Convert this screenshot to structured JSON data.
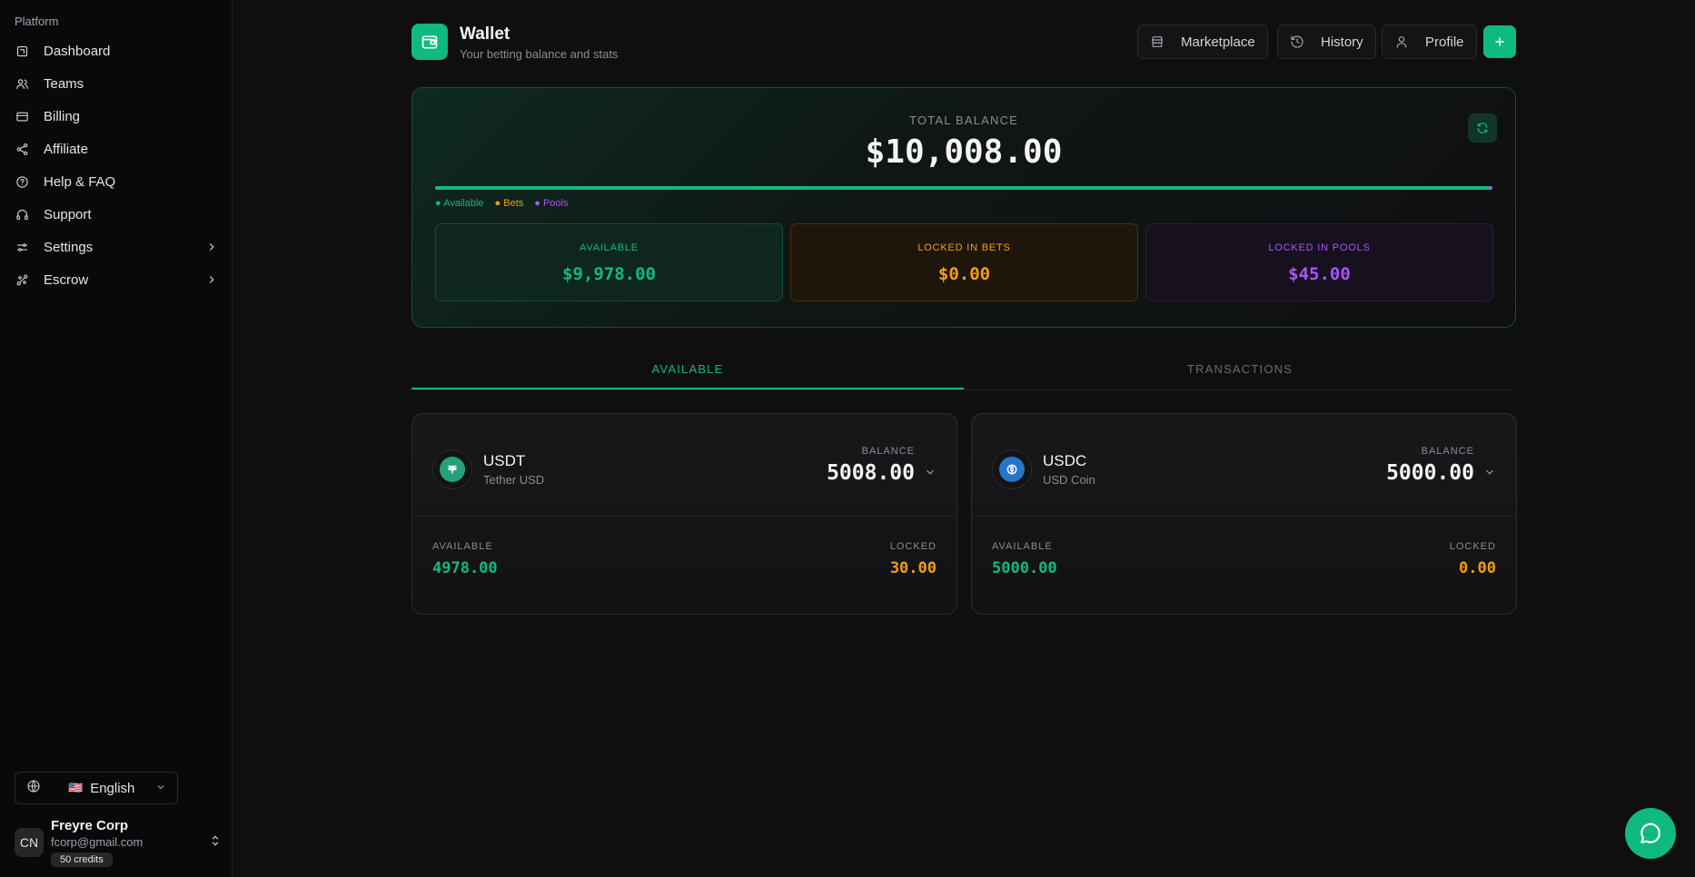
{
  "sidebar": {
    "section_label": "Platform",
    "items": [
      {
        "label": "Dashboard",
        "icon": "dashboard-icon"
      },
      {
        "label": "Teams",
        "icon": "users-icon"
      },
      {
        "label": "Billing",
        "icon": "credit-card-icon"
      },
      {
        "label": "Affiliate",
        "icon": "share-icon"
      },
      {
        "label": "Help & FAQ",
        "icon": "help-circle-icon"
      },
      {
        "label": "Support",
        "icon": "headphones-icon"
      },
      {
        "label": "Settings",
        "icon": "sliders-icon",
        "has_submenu": true
      },
      {
        "label": "Escrow",
        "icon": "link-icon",
        "has_submenu": true
      }
    ],
    "language": {
      "flag": "🇺🇸",
      "label": "English"
    },
    "user": {
      "initials": "CN",
      "name": "Freyre Corp",
      "email": "fcorp@gmail.com",
      "credits": "50 credits"
    }
  },
  "header": {
    "title": "Wallet",
    "subtitle": "Your betting balance and stats",
    "buttons": {
      "marketplace": "Marketplace",
      "history": "History",
      "profile": "Profile"
    }
  },
  "balance": {
    "label": "TOTAL BALANCE",
    "total": "$10,008.00",
    "distribution": {
      "available": 99.7,
      "bets": 0,
      "pools": 0.3
    },
    "legend": {
      "available": "● Available",
      "bets": "● Bets",
      "pools": "● Pools"
    },
    "stats": {
      "available": {
        "label": "AVAILABLE",
        "value": "$9,978.00"
      },
      "bets": {
        "label": "LOCKED IN BETS",
        "value": "$0.00"
      },
      "pools": {
        "label": "LOCKED IN POOLS",
        "value": "$45.00"
      }
    }
  },
  "tabs": {
    "available": "AVAILABLE",
    "transactions": "TRANSACTIONS",
    "active": "available"
  },
  "coins": [
    {
      "symbol": "USDT",
      "name": "Tether USD",
      "balance_label": "BALANCE",
      "balance": "5008.00",
      "available_label": "AVAILABLE",
      "available": "4978.00",
      "locked_label": "LOCKED",
      "locked": "30.00",
      "color": "#26a17b"
    },
    {
      "symbol": "USDC",
      "name": "USD Coin",
      "balance_label": "BALANCE",
      "balance": "5000.00",
      "available_label": "AVAILABLE",
      "available": "5000.00",
      "locked_label": "LOCKED",
      "locked": "0.00",
      "color": "#2775ca"
    }
  ],
  "colors": {
    "accent": "#10b981",
    "bets": "#f59e0b",
    "pools": "#a855f7"
  }
}
